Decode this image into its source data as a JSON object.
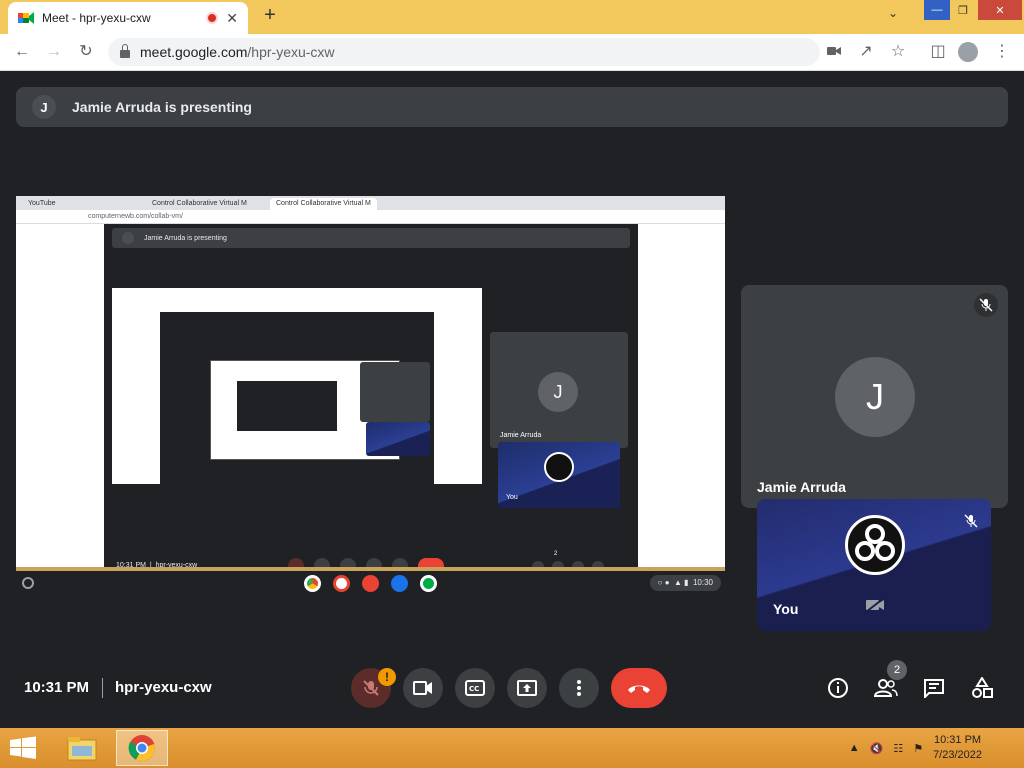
{
  "browser": {
    "tab_title": "Meet - hpr-yexu-cxw",
    "tab_close": "✕",
    "new_tab": "+",
    "url_host": "meet.google.com",
    "url_path": "/hpr-yexu-cxw",
    "window_controls": {
      "minimize": "—",
      "maximize": "❐",
      "close": "✕"
    }
  },
  "presenting_banner": {
    "avatar_letter": "J",
    "text": "Jamie Arruda is presenting"
  },
  "shared_screen": {
    "tabs": [
      "YouTube",
      "Control Collaborative Virtual M",
      "Control Collaborative Virtual M"
    ],
    "url": "computernewb.com/collab-vm/",
    "banner": "Jamie Arruda is presenting",
    "tile_name": "Jamie Arruda",
    "you_label": "You",
    "footer_time": "10:31 PM",
    "footer_code": "hpr-yexu-cxw",
    "participants_badge": "2",
    "tray_time": "10:30"
  },
  "participants": [
    {
      "name": "Jamie Arruda",
      "avatar_letter": "J",
      "muted": true
    },
    {
      "name": "You",
      "muted": true,
      "camera_off": true
    }
  ],
  "controls": {
    "time": "10:31 PM",
    "meeting_code": "hpr-yexu-cxw",
    "mic_warning": "!",
    "participants_count": "2"
  },
  "taskbar": {
    "time": "10:31 PM",
    "date": "7/23/2022"
  },
  "colors": {
    "meet_bg": "#202124",
    "tile_bg": "#3c4043",
    "leave_red": "#ea4335",
    "warning_orange": "#f29900",
    "taskbar": "#e9a443"
  }
}
